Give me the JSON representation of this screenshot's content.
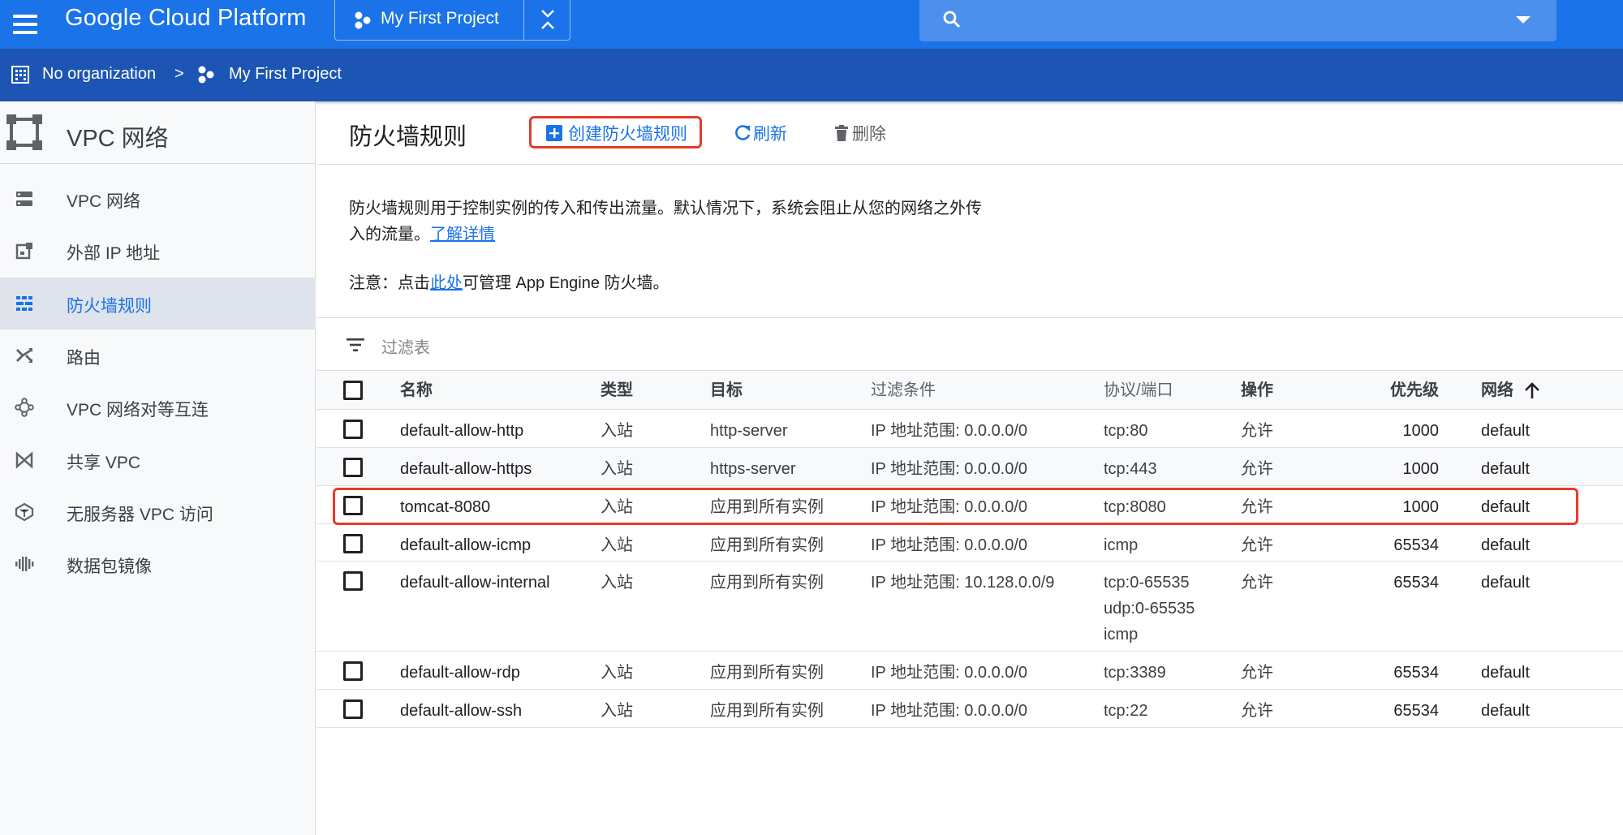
{
  "topbar": {
    "brand": "Google Cloud Platform",
    "project_name": "My First Project",
    "search_placeholder": ""
  },
  "breadcrumb": {
    "organization": "No organization",
    "separator": ">",
    "project": "My First Project"
  },
  "sidebar": {
    "title": "VPC 网络",
    "items": [
      {
        "label": "VPC 网络",
        "icon": "vpc-network-icon",
        "active": false
      },
      {
        "label": "外部 IP 地址",
        "icon": "external-ip-icon",
        "active": false
      },
      {
        "label": "防火墙规则",
        "icon": "firewall-icon",
        "active": true
      },
      {
        "label": "路由",
        "icon": "routes-icon",
        "active": false
      },
      {
        "label": "VPC 网络对等互连",
        "icon": "peering-icon",
        "active": false
      },
      {
        "label": "共享 VPC",
        "icon": "shared-vpc-icon",
        "active": false
      },
      {
        "label": "无服务器 VPC 访问",
        "icon": "serverless-icon",
        "active": false
      },
      {
        "label": "数据包镜像",
        "icon": "packet-mirroring-icon",
        "active": false
      }
    ]
  },
  "page": {
    "title": "防火墙规则",
    "create_label": "创建防火墙规则",
    "refresh_label": "刷新",
    "delete_label": "删除",
    "description_line1": "防火墙规则用于控制实例的传入和传出流量。默认情况下，系统会阻止从您的网络之外传",
    "description_line2": "入的流量。",
    "learn_more": "了解详情",
    "note_prefix": "注意：点击",
    "note_link": "此处",
    "note_suffix": "可管理 App Engine 防火墙。",
    "filter_placeholder": "过滤表"
  },
  "table": {
    "headers": {
      "name": "名称",
      "type": "类型",
      "target": "目标",
      "filter": "过滤条件",
      "protocol": "协议/端口",
      "action": "操作",
      "priority": "优先级",
      "network": "网络"
    },
    "rows": [
      {
        "name": "default-allow-http",
        "type": "入站",
        "target": "http-server",
        "filter": "IP 地址范围: 0.0.0.0/0",
        "protocol": [
          "tcp:80"
        ],
        "action": "允许",
        "priority": "1000",
        "network": "default"
      },
      {
        "name": "default-allow-https",
        "type": "入站",
        "target": "https-server",
        "filter": "IP 地址范围: 0.0.0.0/0",
        "protocol": [
          "tcp:443"
        ],
        "action": "允许",
        "priority": "1000",
        "network": "default"
      },
      {
        "name": "tomcat-8080",
        "type": "入站",
        "target": "应用到所有实例",
        "filter": "IP 地址范围: 0.0.0.0/0",
        "protocol": [
          "tcp:8080"
        ],
        "action": "允许",
        "priority": "1000",
        "network": "default"
      },
      {
        "name": "default-allow-icmp",
        "type": "入站",
        "target": "应用到所有实例",
        "filter": "IP 地址范围: 0.0.0.0/0",
        "protocol": [
          "icmp"
        ],
        "action": "允许",
        "priority": "65534",
        "network": "default"
      },
      {
        "name": "default-allow-internal",
        "type": "入站",
        "target": "应用到所有实例",
        "filter": "IP 地址范围: 10.128.0.0/9",
        "protocol": [
          "tcp:0-65535",
          "udp:0-65535",
          "icmp"
        ],
        "action": "允许",
        "priority": "65534",
        "network": "default"
      },
      {
        "name": "default-allow-rdp",
        "type": "入站",
        "target": "应用到所有实例",
        "filter": "IP 地址范围: 0.0.0.0/0",
        "protocol": [
          "tcp:3389"
        ],
        "action": "允许",
        "priority": "65534",
        "network": "default"
      },
      {
        "name": "default-allow-ssh",
        "type": "入站",
        "target": "应用到所有实例",
        "filter": "IP 地址范围: 0.0.0.0/0",
        "protocol": [
          "tcp:22"
        ],
        "action": "允许",
        "priority": "65534",
        "network": "default"
      }
    ]
  },
  "colors": {
    "topbar": "#1a73e8",
    "crumbbar": "#1c55b3",
    "accent": "#1a73e8",
    "highlight": "#e53b2c"
  }
}
